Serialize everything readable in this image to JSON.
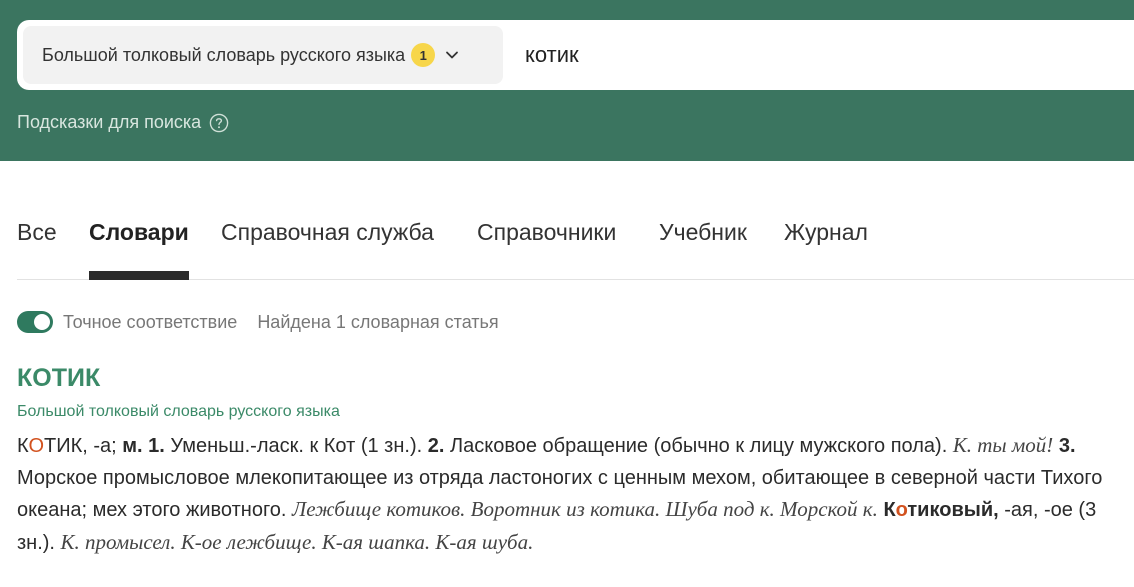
{
  "header": {
    "dictionary_select": {
      "label": "Большой толковый словарь русского языка",
      "badge": "1",
      "icon": "chevron-down-icon"
    },
    "search": {
      "value": "котик"
    },
    "hints": {
      "label": "Подсказки для поиска",
      "icon": "help-icon"
    }
  },
  "tabs": [
    {
      "label": "Все",
      "active": false
    },
    {
      "label": "Словари",
      "active": true
    },
    {
      "label": "Справочная служба",
      "active": false
    },
    {
      "label": "Справочники",
      "active": false
    },
    {
      "label": "Учебник",
      "active": false
    },
    {
      "label": "Журнал",
      "active": false
    }
  ],
  "filters": {
    "exact_match": {
      "label": "Точное соответствие",
      "enabled": true
    },
    "found_count": "Найдена 1 словарная статья"
  },
  "entry": {
    "title": "КОТИК",
    "source": "Большой толковый словарь русского языка",
    "head_pre": "К",
    "head_stress": "О",
    "head_post": "ТИК",
    "t1": ", -а; ",
    "b1": "м. 1.",
    "t2": " Уменьш.-ласк. к Кот (1 зн.). ",
    "b2": "2.",
    "t3": " Ласковое обращение (обычно к лицу мужского пола). ",
    "i1": "К. ты мой!",
    "t4": " ",
    "b3": "3.",
    "t5": " Морское промысловое млекопитающее из отряда ластоногих с ценным мехом, обитающее в северной части Тихого океана; мех этого животного. ",
    "i2": "Лежбище котиков. Воротник из котика. Шуба под к. Морской к.",
    "t6": " ",
    "b4_pre": "К",
    "b4_stress": "о",
    "b4_post": "тиковый,",
    "t7": " -ая, -ое (3 зн.). ",
    "i3": "К. промысел. К-ое лежбище. К-ая шапка. К-ая шуба."
  },
  "colors": {
    "header_bg": "#3b7560",
    "accent_green": "#3b8a68",
    "toggle_on": "#2f7a5f",
    "badge": "#f7d64a",
    "stress": "#d2521f"
  }
}
